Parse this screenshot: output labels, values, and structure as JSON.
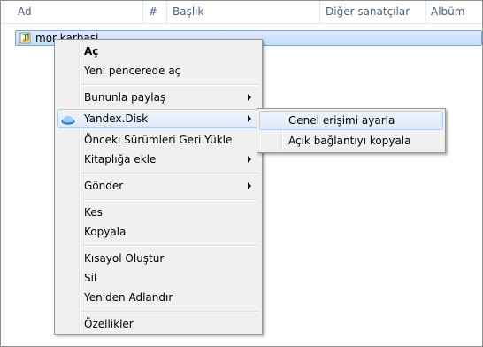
{
  "columns": [
    {
      "label": "Ad"
    },
    {
      "label": "#"
    },
    {
      "label": "Başlık"
    },
    {
      "label": "Diğer sanatçılar"
    },
    {
      "label": "Albüm"
    }
  ],
  "file": {
    "name": "mor karbasi",
    "icon": "audio-file-icon"
  },
  "context_menu": {
    "items": [
      {
        "label": "Aç",
        "bold": true
      },
      {
        "label": "Yeni pencerede aç"
      },
      {
        "label": "Bununla paylaş",
        "submenu": true
      },
      {
        "label": "Yandex.Disk",
        "submenu": true,
        "icon": "yandex-disk-icon",
        "highlighted": true
      },
      {
        "label": "Önceki Sürümleri Geri Yükle"
      },
      {
        "label": "Kitaplığa ekle",
        "submenu": true
      },
      {
        "label": "Gönder",
        "submenu": true
      },
      {
        "label": "Kes"
      },
      {
        "label": "Kopyala"
      },
      {
        "label": "Kısayol Oluştur"
      },
      {
        "label": "Sil"
      },
      {
        "label": "Yeniden Adlandır"
      },
      {
        "label": "Özellikler"
      }
    ]
  },
  "submenu": {
    "items": [
      {
        "label": "Genel erişimi ayarla",
        "highlighted": true
      },
      {
        "label": "Açık bağlantıyı kopyala"
      }
    ]
  },
  "colors": {
    "header_text": "#4c607a",
    "selection": "#c1dcfc",
    "menu_background": "#f0f0f0",
    "hover_border": "#aecff7"
  }
}
